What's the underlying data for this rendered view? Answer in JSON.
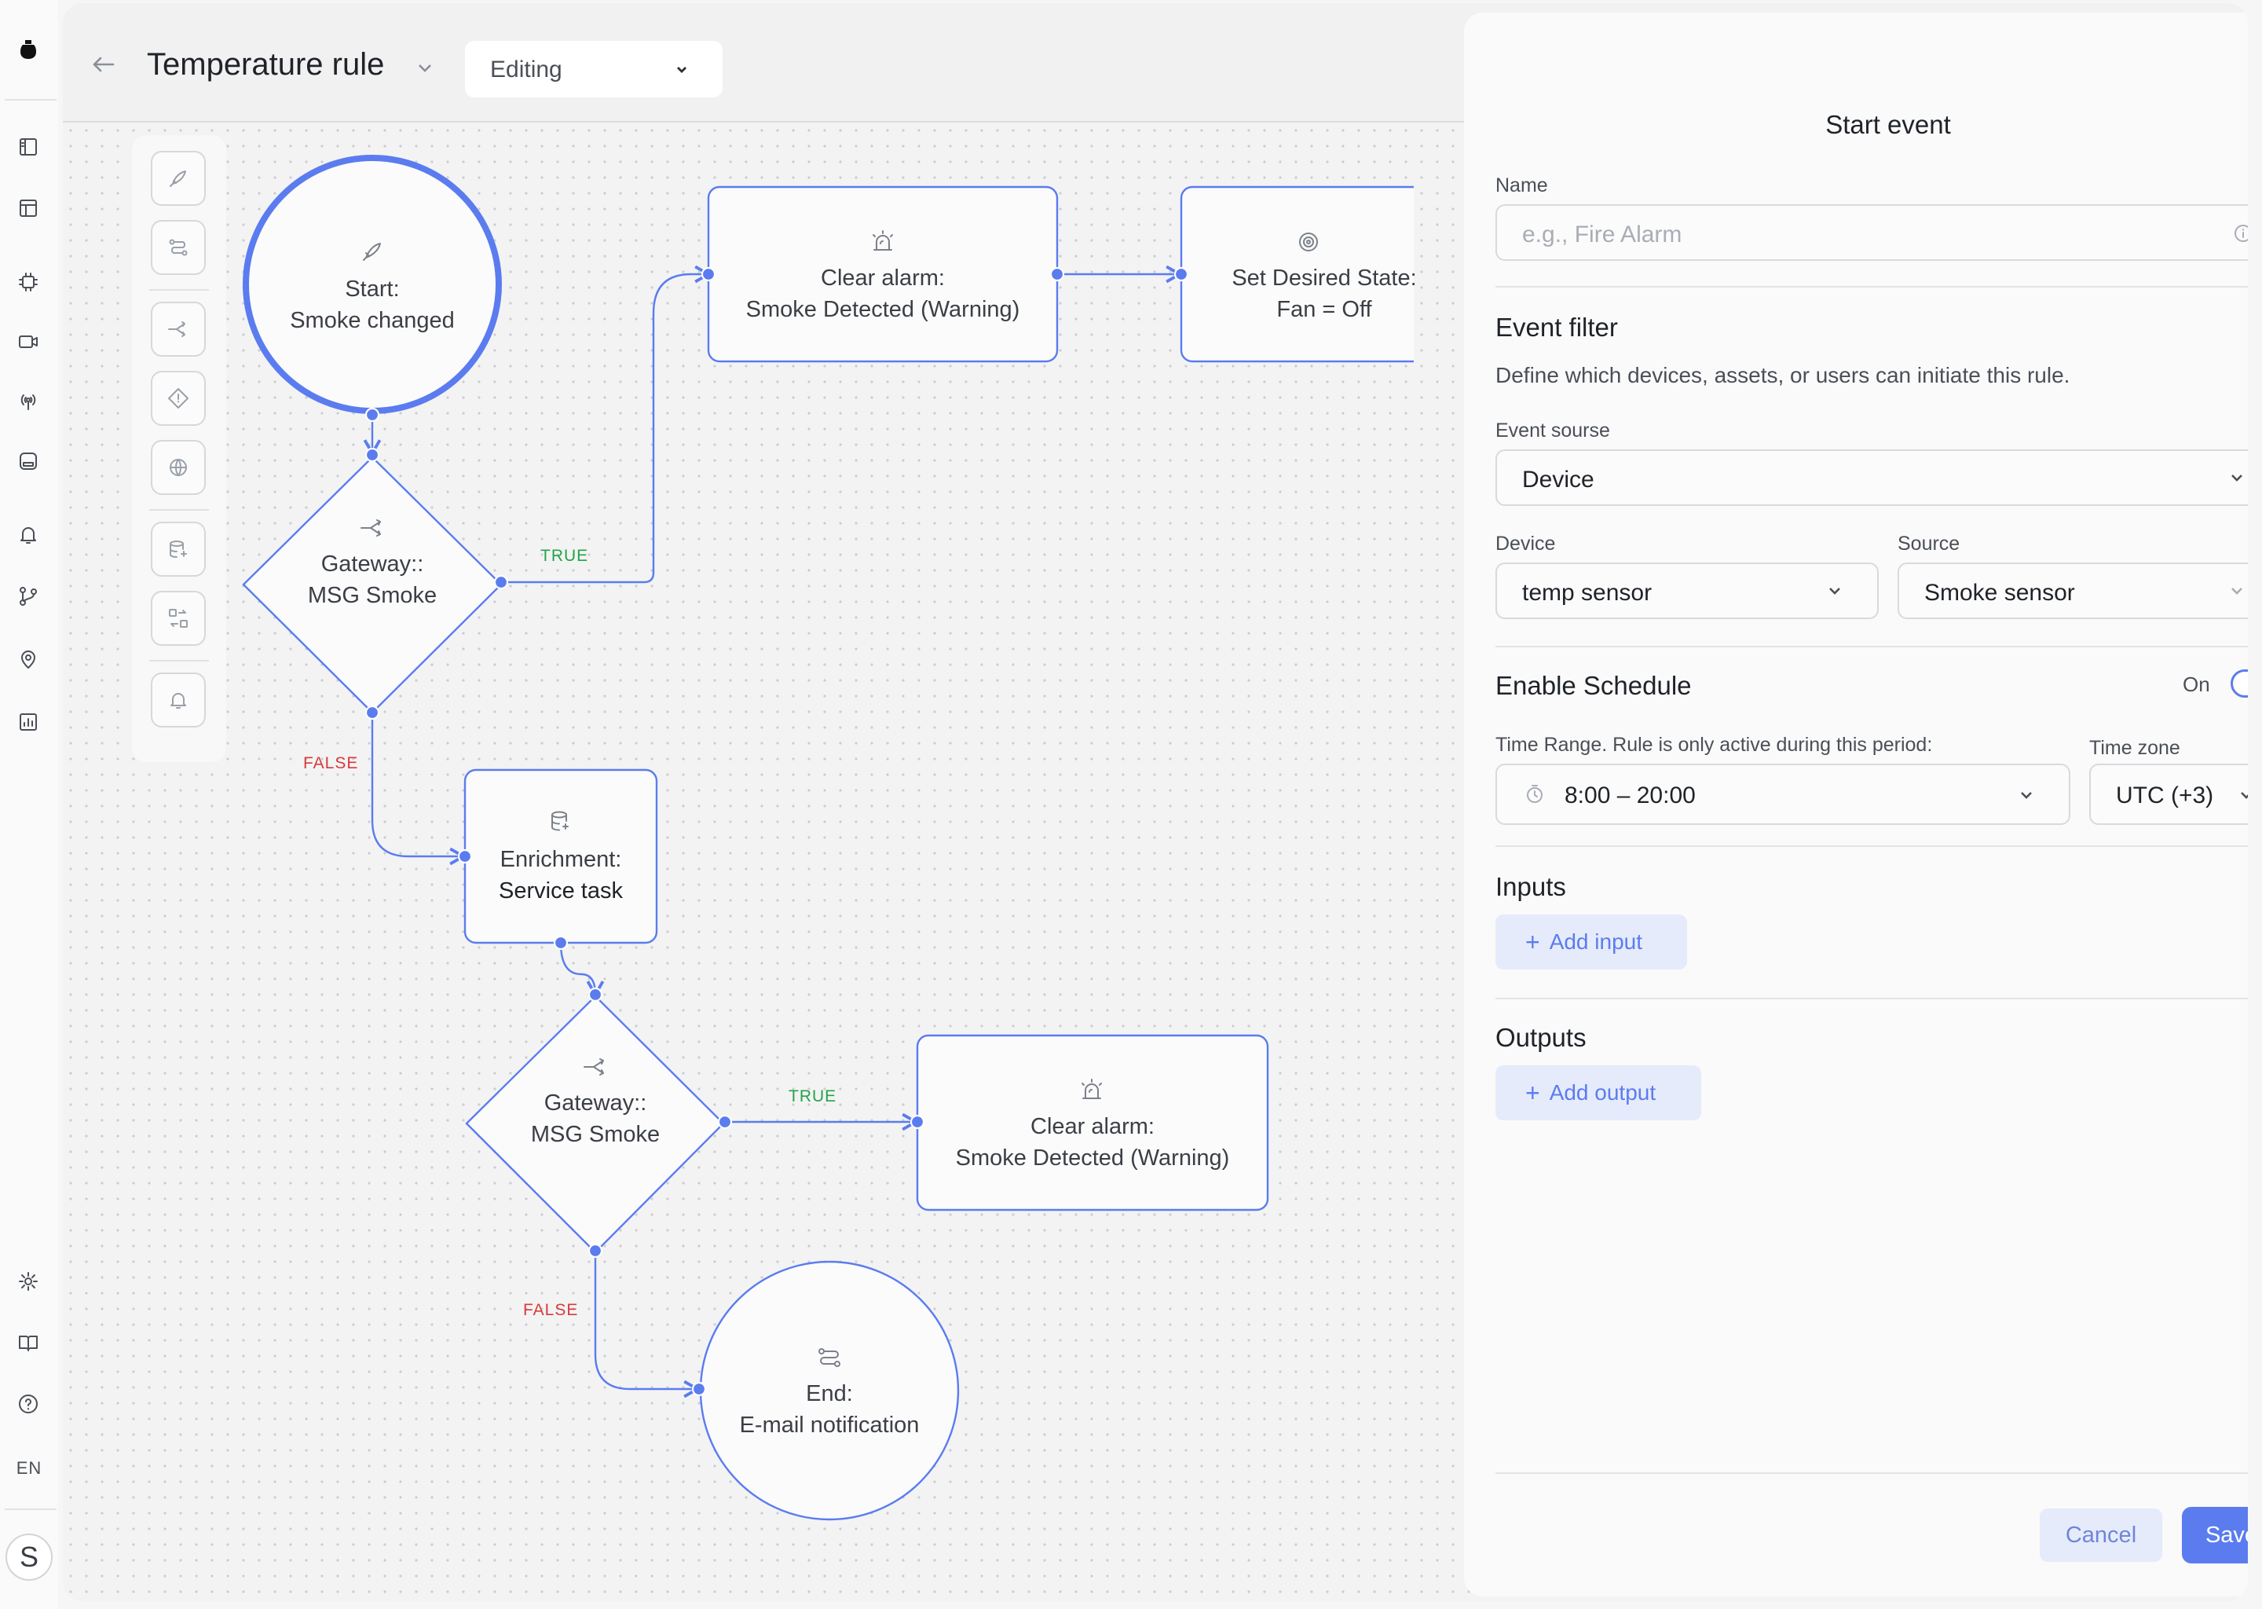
{
  "app": {
    "logo_icon": "pot-logo-icon"
  },
  "rail": {
    "items": [
      {
        "name": "dashboard-icon"
      },
      {
        "name": "layout-icon"
      },
      {
        "name": "chip-icon"
      },
      {
        "name": "video-icon"
      },
      {
        "name": "antenna-icon"
      },
      {
        "name": "storage-icon"
      },
      {
        "name": "bell-icon"
      },
      {
        "name": "git-branch-icon"
      },
      {
        "name": "map-pin-icon"
      },
      {
        "name": "chart-icon"
      },
      {
        "name": "settings-icon"
      },
      {
        "name": "book-icon"
      },
      {
        "name": "help-icon"
      }
    ],
    "language": "EN",
    "avatar_initial": "S"
  },
  "header": {
    "title": "Temperature rule",
    "mode": "Editing"
  },
  "palette": {
    "tools": [
      "start-event-tool",
      "task-tool",
      "gateway-tool",
      "alarm-tool",
      "web-tool",
      "enrichment-tool",
      "transform-tool",
      "notification-tool"
    ]
  },
  "flow": {
    "start": {
      "line1": "Start:",
      "line2": "Smoke changed"
    },
    "gateway1": {
      "line1": "Gateway::",
      "line2": "MSG Smoke"
    },
    "clear_alarm1": {
      "line1": "Clear alarm:",
      "line2": "Smoke Detected (Warning)"
    },
    "set_state": {
      "line1": "Set Desired State:",
      "line2": "Fan = Off"
    },
    "enrichment": {
      "line1": "Enrichment:",
      "line2": "Service task"
    },
    "gateway2": {
      "line1": "Gateway::",
      "line2": "MSG Smoke"
    },
    "clear_alarm2": {
      "line1": "Clear alarm:",
      "line2": "Smoke Detected (Warning)"
    },
    "end": {
      "line1": "End:",
      "line2": "E-mail notification"
    },
    "true_label": "TRUE",
    "false_label": "FALSE",
    "colors": {
      "accent": "#5b7cef",
      "true": "#22a447",
      "false": "#d93a3a"
    }
  },
  "panel": {
    "title": "Start event",
    "name_label": "Name",
    "name_placeholder": "e.g., Fire Alarm",
    "event_filter_title": "Event filter",
    "event_filter_desc": "Define which devices, assets, or users can initiate this rule.",
    "event_source_label": "Event sourse",
    "event_source_value": "Device",
    "device_label": "Device",
    "device_value": "temp sensor",
    "source_label": "Source",
    "source_value": "Smoke sensor",
    "schedule_title": "Enable Schedule",
    "schedule_state": "On",
    "schedule_enabled": true,
    "time_range_label": "Time Range. Rule is only active during this period:",
    "time_range_value": "8:00 – 20:00",
    "timezone_label": "Time zone",
    "timezone_value": "UTC (+3)",
    "inputs_title": "Inputs",
    "add_input_label": "Add input",
    "outputs_title": "Outputs",
    "add_output_label": "Add output",
    "cancel_label": "Cancel",
    "save_label": "Save"
  }
}
